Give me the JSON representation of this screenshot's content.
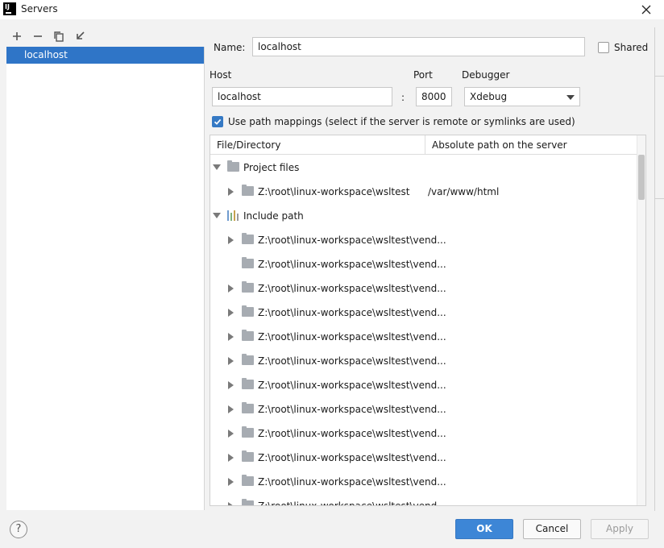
{
  "window": {
    "title": "Servers",
    "app_logo": "IJ"
  },
  "toolbar": {
    "buttons": [
      "add-icon",
      "remove-icon",
      "copy-icon",
      "import-icon"
    ]
  },
  "server_list": {
    "items": [
      {
        "label": "localhost",
        "selected": true
      }
    ]
  },
  "form": {
    "name_label": "Name:",
    "name_value": "localhost",
    "shared_label": "Shared",
    "shared_checked": false,
    "host_label": "Host",
    "host_value": "localhost",
    "colon": ":",
    "port_label": "Port",
    "port_value": "8000",
    "debugger_label": "Debugger",
    "debugger_value": "Xdebug",
    "use_path_mappings_label": "Use path mappings (select if the server is remote or symlinks are used)",
    "use_path_mappings_checked": true
  },
  "table": {
    "columns": [
      "File/Directory",
      "Absolute path on the server"
    ],
    "rows": [
      {
        "text": "Project files",
        "path": "",
        "level": 0,
        "expander": "down",
        "icon": "folder-icon"
      },
      {
        "text": "Z:\\root\\linux-workspace\\wsltest",
        "path": "/var/www/html",
        "level": 1,
        "expander": "right",
        "icon": "folder-icon"
      },
      {
        "text": "Include path",
        "path": "",
        "level": 0,
        "expander": "down",
        "icon": "library-icon"
      },
      {
        "text": "Z:\\root\\linux-workspace\\wsltest\\vend...",
        "path": "",
        "level": 1,
        "expander": "right",
        "icon": "folder-icon"
      },
      {
        "text": "Z:\\root\\linux-workspace\\wsltest\\vend...",
        "path": "",
        "level": 1,
        "expander": "none",
        "icon": "folder-icon"
      },
      {
        "text": "Z:\\root\\linux-workspace\\wsltest\\vend...",
        "path": "",
        "level": 1,
        "expander": "right",
        "icon": "folder-icon"
      },
      {
        "text": "Z:\\root\\linux-workspace\\wsltest\\vend...",
        "path": "",
        "level": 1,
        "expander": "right",
        "icon": "folder-icon"
      },
      {
        "text": "Z:\\root\\linux-workspace\\wsltest\\vend...",
        "path": "",
        "level": 1,
        "expander": "right",
        "icon": "folder-icon"
      },
      {
        "text": "Z:\\root\\linux-workspace\\wsltest\\vend...",
        "path": "",
        "level": 1,
        "expander": "right",
        "icon": "folder-icon"
      },
      {
        "text": "Z:\\root\\linux-workspace\\wsltest\\vend...",
        "path": "",
        "level": 1,
        "expander": "right",
        "icon": "folder-icon"
      },
      {
        "text": "Z:\\root\\linux-workspace\\wsltest\\vend...",
        "path": "",
        "level": 1,
        "expander": "right",
        "icon": "folder-icon"
      },
      {
        "text": "Z:\\root\\linux-workspace\\wsltest\\vend...",
        "path": "",
        "level": 1,
        "expander": "right",
        "icon": "folder-icon"
      },
      {
        "text": "Z:\\root\\linux-workspace\\wsltest\\vend...",
        "path": "",
        "level": 1,
        "expander": "right",
        "icon": "folder-icon"
      },
      {
        "text": "Z:\\root\\linux-workspace\\wsltest\\vend...",
        "path": "",
        "level": 1,
        "expander": "right",
        "icon": "folder-icon"
      },
      {
        "text": "Z:\\root\\linux-workspace\\wsltest\\vend...",
        "path": "",
        "level": 1,
        "expander": "right",
        "icon": "folder-icon"
      }
    ]
  },
  "footer": {
    "help": "?",
    "ok": "OK",
    "cancel": "Cancel",
    "apply": "Apply"
  },
  "colors": {
    "accent": "#2f75c7",
    "primary_button": "#3d86d6",
    "folder": "#a7acb2"
  }
}
